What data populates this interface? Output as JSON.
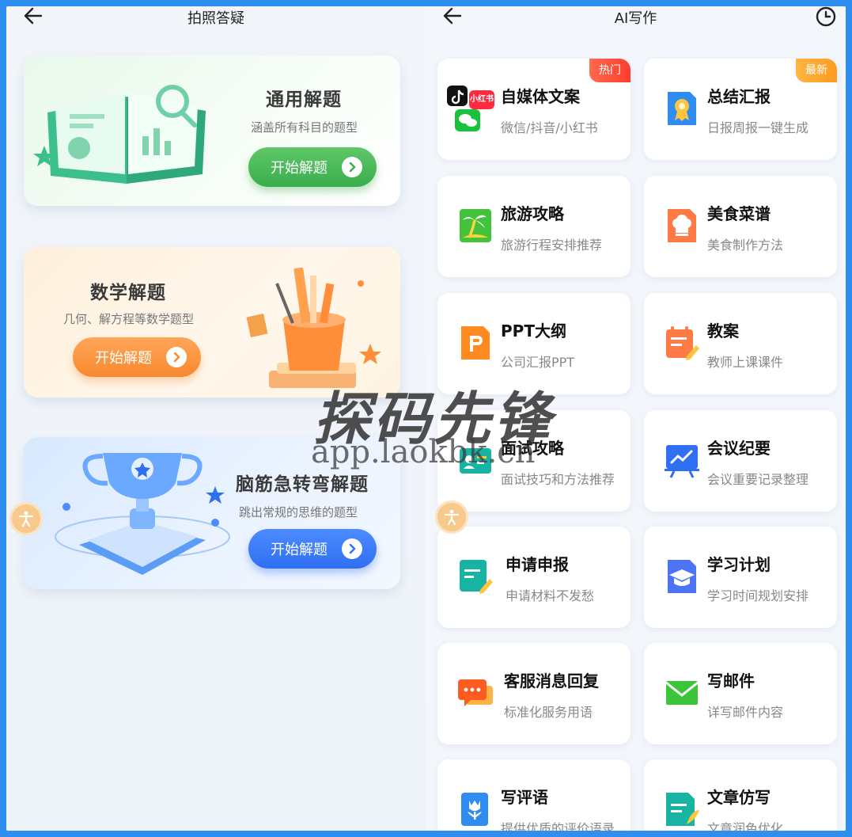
{
  "left": {
    "title": "拍照答疑",
    "cards": [
      {
        "title": "通用解题",
        "subtitle": "涵盖所有科目的题型",
        "button": "开始解题"
      },
      {
        "title": "数学解题",
        "subtitle": "几何、解方程等数学题型",
        "button": "开始解题"
      },
      {
        "title": "脑筋急转弯解题",
        "subtitle": "跳出常规的思维的题型",
        "button": "开始解题"
      }
    ]
  },
  "right": {
    "title": "AI写作",
    "tiles": [
      {
        "title": "自媒体文案",
        "subtitle": "微信/抖音/小红书",
        "badge": "热门",
        "icon": "social-media-icon"
      },
      {
        "title": "总结汇报",
        "subtitle": "日报周报一键生成",
        "badge": "最新",
        "icon": "report-icon"
      },
      {
        "title": "旅游攻略",
        "subtitle": "旅游行程安排推荐",
        "icon": "palm-tree-icon"
      },
      {
        "title": "美食菜谱",
        "subtitle": "美食制作方法",
        "icon": "chef-hat-icon"
      },
      {
        "title": "PPT大纲",
        "subtitle": "公司汇报PPT",
        "icon": "ppt-icon"
      },
      {
        "title": "教案",
        "subtitle": "教师上课课件",
        "icon": "lesson-plan-icon"
      },
      {
        "title": "面试攻略",
        "subtitle": "面试技巧和方法推荐",
        "icon": "interview-icon"
      },
      {
        "title": "会议纪要",
        "subtitle": "会议重要记录整理",
        "icon": "meeting-board-icon"
      },
      {
        "title": "申请申报",
        "subtitle": "申请材料不发愁",
        "icon": "application-icon"
      },
      {
        "title": "学习计划",
        "subtitle": "学习时间规划安排",
        "icon": "graduation-cap-icon"
      },
      {
        "title": "客服消息回复",
        "subtitle": "标准化服务用语",
        "icon": "chat-bubble-icon"
      },
      {
        "title": "写邮件",
        "subtitle": "详写邮件内容",
        "icon": "mail-icon"
      },
      {
        "title": "写评语",
        "subtitle": "提供优质的评价语录",
        "icon": "tulip-icon"
      },
      {
        "title": "文章仿写",
        "subtitle": "文章润色优化",
        "icon": "article-icon"
      }
    ]
  },
  "social_labels": {
    "xiaohongshu": "小红书"
  },
  "watermark": {
    "text": "探码先锋",
    "url": "app.laokbk.cn"
  }
}
